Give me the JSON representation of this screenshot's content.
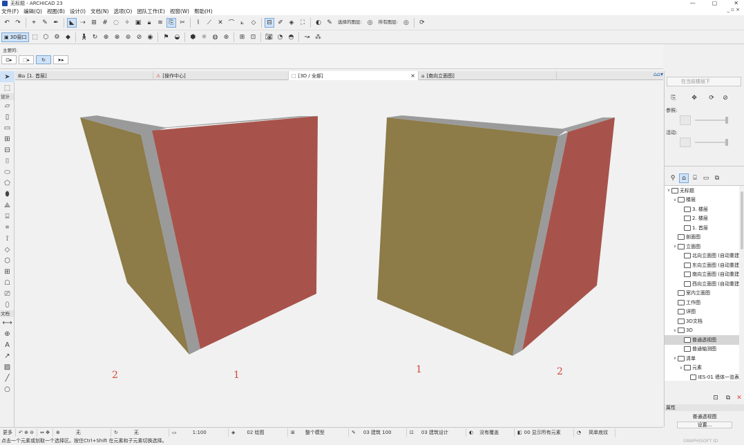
{
  "window": {
    "title": "无标题 - ARCHICAD 23",
    "min": "—",
    "max": "▢",
    "close": "✕"
  },
  "menu": [
    "文件(F)",
    "编辑(Q)",
    "视图(B)",
    "设计(I)",
    "文档(N)",
    "选项(O)",
    "团队工作(E)",
    "视窗(W)",
    "帮助(H)"
  ],
  "menu_mdi": "_ ▫ ×",
  "toolbar1": {
    "layer_label": "选择的图层:",
    "all_layers_label": "所有图层:"
  },
  "toolbar2": {
    "window3d_label": "3D窗口"
  },
  "infobox": {
    "main_label": "主要的:"
  },
  "tabs": [
    {
      "label": "[1. 首层]"
    },
    {
      "label": "[操作中心]"
    },
    {
      "label": "[3D / 全部]",
      "close": "×"
    },
    {
      "label": "[南向立面图]"
    }
  ],
  "toolbox": {
    "section_design": "设计",
    "section_doc": "文档"
  },
  "viewport": {
    "labels": [
      "2",
      "1",
      "1",
      "2"
    ],
    "colors": {
      "ochre": "#8d7b48",
      "red": "#a7534b",
      "gray": "#9a9a9a"
    }
  },
  "right_panel": {
    "floor_combo": "在当前楼层下",
    "ref_label": "参照:",
    "active_label": "活动:",
    "tree": [
      {
        "label": "无标题",
        "level": 0,
        "tw": "∨"
      },
      {
        "label": "楼层",
        "level": 1,
        "tw": "∨"
      },
      {
        "label": "3. 楼层",
        "level": 2,
        "tw": ""
      },
      {
        "label": "2. 楼层",
        "level": 2,
        "tw": ""
      },
      {
        "label": "1. 首层",
        "level": 2,
        "tw": ""
      },
      {
        "label": "剖面图",
        "level": 1,
        "tw": ""
      },
      {
        "label": "立面图",
        "level": 1,
        "tw": "∨"
      },
      {
        "label": "北向立面图 (自动重建",
        "level": 2,
        "tw": ""
      },
      {
        "label": "东向立面图 (自动重建",
        "level": 2,
        "tw": ""
      },
      {
        "label": "南向立面图 (自动重建",
        "level": 2,
        "tw": ""
      },
      {
        "label": "西向立面图 (自动重建",
        "level": 2,
        "tw": ""
      },
      {
        "label": "室内立面图",
        "level": 1,
        "tw": ""
      },
      {
        "label": "工作图",
        "level": 1,
        "tw": ""
      },
      {
        "label": "详图",
        "level": 1,
        "tw": ""
      },
      {
        "label": "3D文档",
        "level": 1,
        "tw": ""
      },
      {
        "label": "3D",
        "level": 1,
        "tw": "∨"
      },
      {
        "label": "普通透视图",
        "level": 2,
        "tw": "",
        "selected": true
      },
      {
        "label": "普通轴测图",
        "level": 2,
        "tw": ""
      },
      {
        "label": "清单",
        "level": 1,
        "tw": "∨"
      },
      {
        "label": "元素",
        "level": 2,
        "tw": "∨"
      },
      {
        "label": "IES-01 墙体一览表",
        "level": 3,
        "tw": ""
      }
    ],
    "properties_label": "属性",
    "properties_value": "普通透视图",
    "settings_button": "设置..."
  },
  "statusbar": {
    "more": "更多",
    "none1": "无",
    "none2": "无",
    "scale": "1:100",
    "layer_combo": "02 绘图",
    "model_combo": "整个模型",
    "pen_set": "03 建筑 100",
    "model_view": "03 建筑设计",
    "override": "没有覆盖",
    "renovation": "00 显示所有元素",
    "structure": "简单底纹"
  },
  "hint": "点击一个元素或划取一个选择区。按住Ctrl+Shift 在元素和子元素切换选择。",
  "brand": "GRAPHISOFT ID"
}
